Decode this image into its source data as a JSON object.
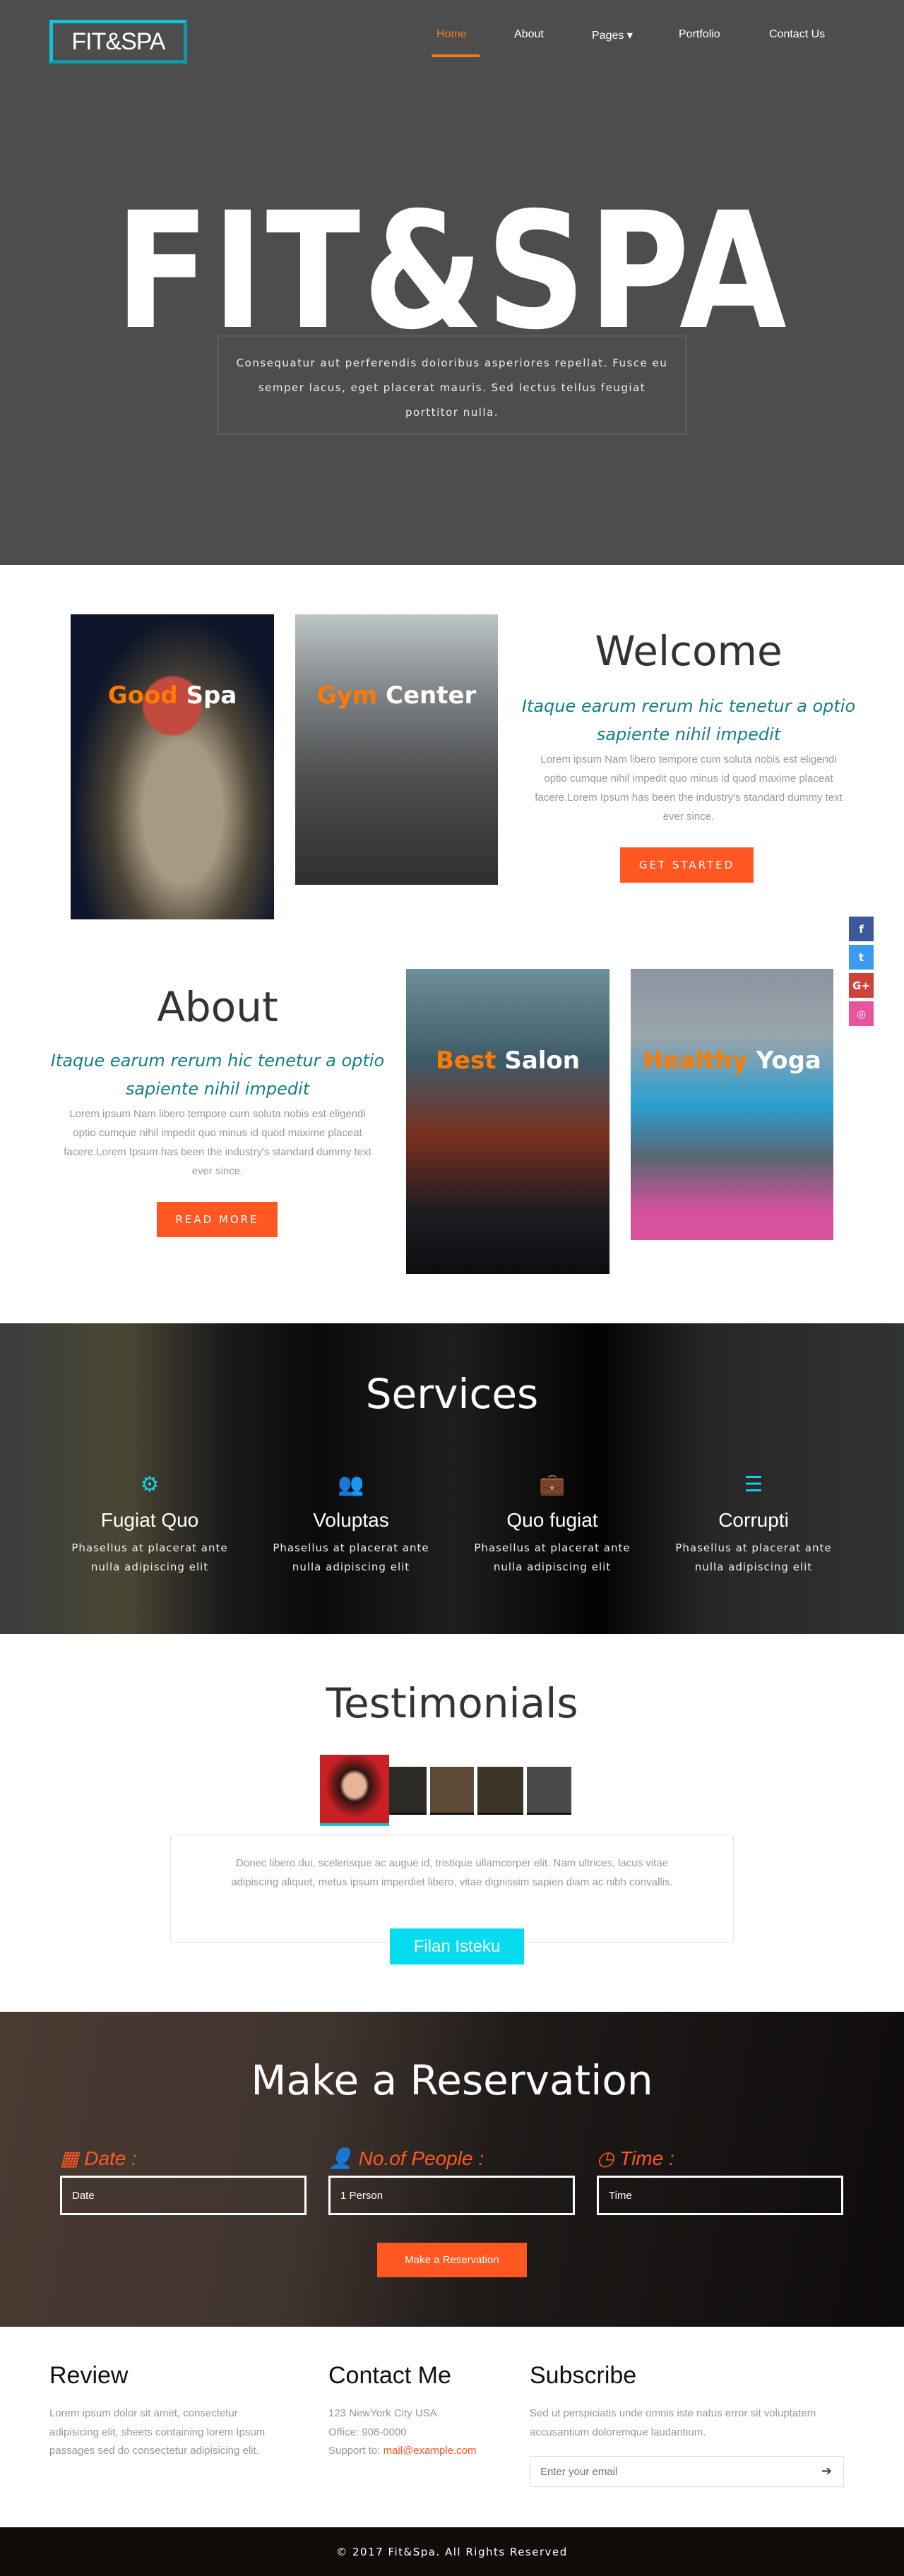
{
  "header": {
    "logo": "FIT&SPA",
    "nav": [
      "Home",
      "About",
      "Pages ▾",
      "Portfolio",
      "Contact Us"
    ],
    "active": "Home"
  },
  "hero": {
    "title": "FIT&SPA",
    "text": "Consequatur aut perferendis doloribus asperiores repellat. Fusce eu semper lacus, eget placerat mauris. Sed lectus tellus feugiat porttitor nulla."
  },
  "welcome": {
    "cards": [
      {
        "accent": "Good",
        "rest": "Spa"
      },
      {
        "accent": "Gym",
        "rest": "Center"
      }
    ],
    "title": "Welcome",
    "subtitle": "Itaque earum rerum hic tenetur a optio sapiente nihil impedit",
    "text": "Lorem ipsum Nam libero tempore cum soluta nobis est eligendi optio cumque nihil impedit quo minus id quod maxime placeat facere.Lorem Ipsum has been the industry's standard dummy text ever since.",
    "button": "GET STARTED"
  },
  "about": {
    "cards": [
      {
        "accent": "Best",
        "rest": "Salon"
      },
      {
        "accent": "Healthy",
        "rest": "Yoga"
      }
    ],
    "title": "About",
    "subtitle": "Itaque earum rerum hic tenetur a optio sapiente nihil impedit",
    "text": "Lorem ipsum Nam libero tempore cum soluta nobis est eligendi optio cumque nihil impedit quo minus id quod maxime placeat facere.Lorem Ipsum has been the industry's standard dummy text ever since.",
    "button": "READ MORE"
  },
  "social": [
    {
      "icon": "facebook-icon",
      "glyph": "f",
      "color": "#3b5998"
    },
    {
      "icon": "twitter-icon",
      "glyph": "t",
      "color": "#3a9bf0"
    },
    {
      "icon": "google-plus-icon",
      "glyph": "G+",
      "color": "#d0413a"
    },
    {
      "icon": "dribbble-icon",
      "glyph": "◎",
      "color": "#e8559b"
    }
  ],
  "services": {
    "title": "Services",
    "items": [
      {
        "icon": "gears-icon",
        "glyph": "⚙",
        "title": "Fugiat Quo",
        "text": "Phasellus at placerat ante nulla adipiscing elit"
      },
      {
        "icon": "users-icon",
        "glyph": "👥",
        "title": "Voluptas",
        "text": "Phasellus at placerat ante nulla adipiscing elit"
      },
      {
        "icon": "briefcase-icon",
        "glyph": "💼",
        "title": "Quo fugiat",
        "text": "Phasellus at placerat ante nulla adipiscing elit"
      },
      {
        "icon": "list-icon",
        "glyph": "☰",
        "title": "Corrupti",
        "text": "Phasellus at placerat ante nulla adipiscing elit"
      }
    ]
  },
  "testimonials": {
    "title": "Testimonials",
    "quote": "Donec libero dui, scelerisque ac augue id, tristique ullamcorper elit. Nam ultrices, lacus vitae adipiscing aliquet, metus ipsum imperdiet libero, vitae dignissim sapien diam ac nibh convallis.",
    "name": "Filan Isteku"
  },
  "reservation": {
    "title": "Make a Reservation",
    "fields": [
      {
        "label": "Date :",
        "icon": "calendar-icon",
        "value": "Date"
      },
      {
        "label": "No.of People :",
        "icon": "user-icon",
        "value": "1 Person"
      },
      {
        "label": "Time :",
        "icon": "clock-icon",
        "value": "Time"
      }
    ],
    "button": "Make a Reservation"
  },
  "footer": {
    "review": {
      "title": "Review",
      "text": "Lorem ipsum dolor sit amet, consectetur adipisicing elit, sheets containing lorem Ipsum passages sed do consectetur adipisicing elit."
    },
    "contact": {
      "title": "Contact Me",
      "address": "123 NewYork City USA.",
      "office": "Office: 908-0000",
      "support_label": "Support to: ",
      "email": "mail@example.com"
    },
    "subscribe": {
      "title": "Subscribe",
      "text": "Sed ut perspiciatis unde omnis iste natus error sit voluptatem accusantium doloremque laudantium.",
      "placeholder": "Enter your email"
    },
    "copyright": "© 2017 Fit&Spa. All Rights Reserved"
  },
  "colors": {
    "accent": "#ff5722",
    "cyan": "#10c4d8",
    "teal": "#127f86",
    "nav_active": "#f07b18"
  }
}
